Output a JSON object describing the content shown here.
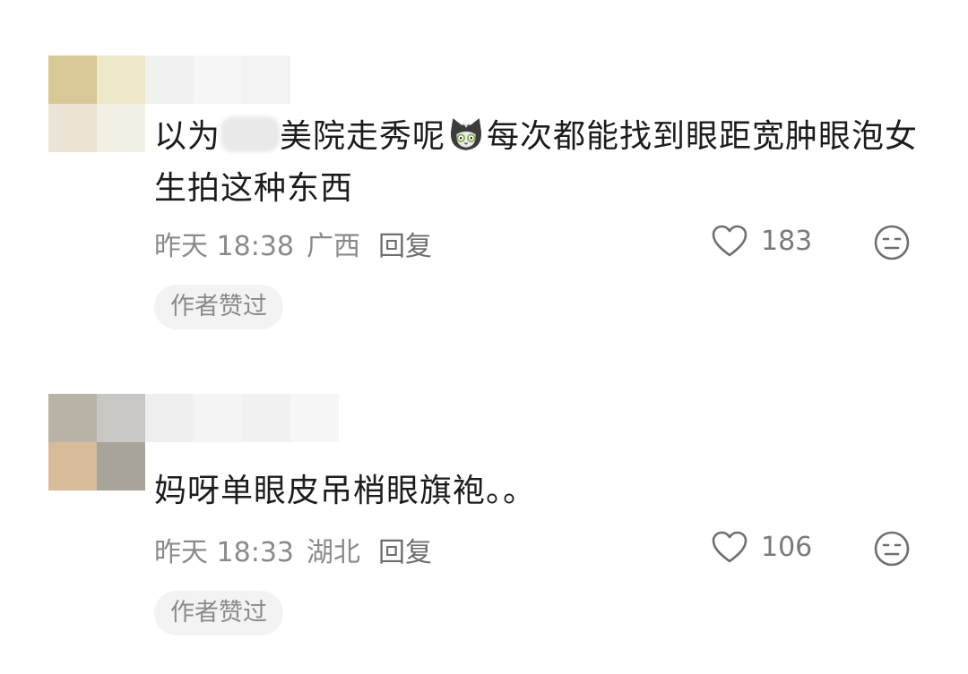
{
  "comments": [
    {
      "avatar_colors": [
        "#d8c898",
        "#ede8c8",
        "#ebe3d3",
        "#f3f0e6"
      ],
      "username_colors": [
        "#f1f1f1",
        "#f6f6f6",
        "#f3f3f3"
      ],
      "text_part1": "以为",
      "text_part2": "美院走秀呢",
      "text_part3": "每次都能找到眼距宽肿眼泡女生拍这种东西",
      "time": "昨天 18:38",
      "location": "广西",
      "reply_label": "回复",
      "likes": "183",
      "badge": "作者赞过"
    },
    {
      "avatar_colors": [
        "#b9b2a6",
        "#c9c7c4",
        "#d7bb9b",
        "#a9a49a"
      ],
      "username_colors": [
        "#efefef",
        "#f4f4f4",
        "#f1f1f1",
        "#f6f6f6"
      ],
      "text_full": "妈呀单眼皮吊梢眼旗袍。。",
      "time": "昨天 18:33",
      "location": "湖北",
      "reply_label": "回复",
      "likes": "106",
      "badge": "作者赞过"
    }
  ],
  "icons": {
    "like": "heart-outline-icon",
    "emoji": "emoji-face-icon",
    "inline": "cat-emoji-icon"
  },
  "colors": {
    "text": "#1c1c1c",
    "meta": "#8a8a8a",
    "badge_bg": "#f3f3f3"
  }
}
